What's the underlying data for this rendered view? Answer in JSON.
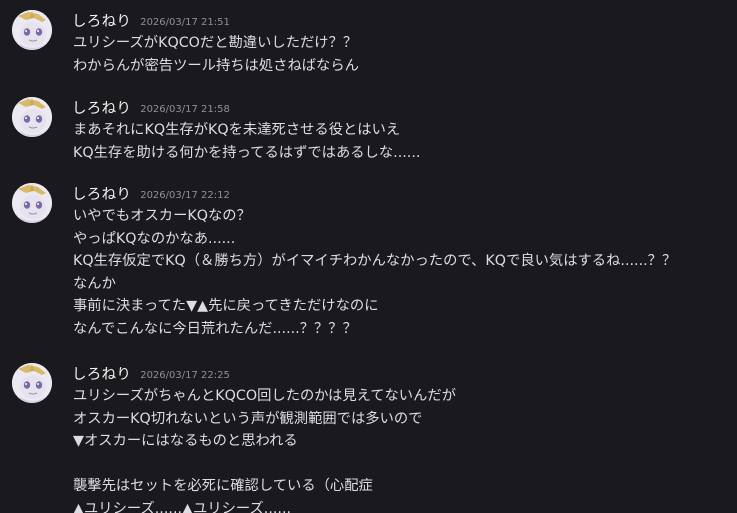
{
  "messages": [
    {
      "username": "しろねり",
      "timestamp": "2026/03/17 21:51",
      "lines": [
        "ユリシーズがKQCOだと勘違いしただけ？？",
        "わからんが密告ツール持ちは処さねばならん"
      ]
    },
    {
      "username": "しろねり",
      "timestamp": "2026/03/17 21:58",
      "lines": [
        "まあそれにKQ生存がKQを未達死させる役とはいえ",
        "KQ生存を助ける何かを持ってるはずではあるしな......"
      ]
    },
    {
      "username": "しろねり",
      "timestamp": "2026/03/17 22:12",
      "lines": [
        "いやでもオスカーKQなの？",
        "やっぱKQなのかなあ......",
        "KQ生存仮定でKQ（＆勝ち方）がイマイチわかんなかったので、KQで良い気はするね......？？",
        "なんか",
        "事前に決まってた▼▲先に戻ってきただけなのに",
        "なんでこんなに今日荒れたんだ......？？？？"
      ]
    },
    {
      "username": "しろねり",
      "timestamp": "2026/03/17 22:25",
      "lines": [
        "ユリシーズがちゃんとKQCO回したのかは見えてないんだが",
        "オスカーKQ切れないという声が観測範囲では多いので",
        "▼オスカーにはなるものと思われる",
        "",
        "襲撃先はセットを必死に確認している（心配症",
        "▲ユリシーズ......▲ユリシーズ......"
      ]
    }
  ],
  "colors": {
    "background": "#1a1a1e",
    "username": "#f2f3f5",
    "timestamp": "#8d9098",
    "text": "#dbdee1"
  },
  "avatar_icon": "unicorn-avatar-icon"
}
